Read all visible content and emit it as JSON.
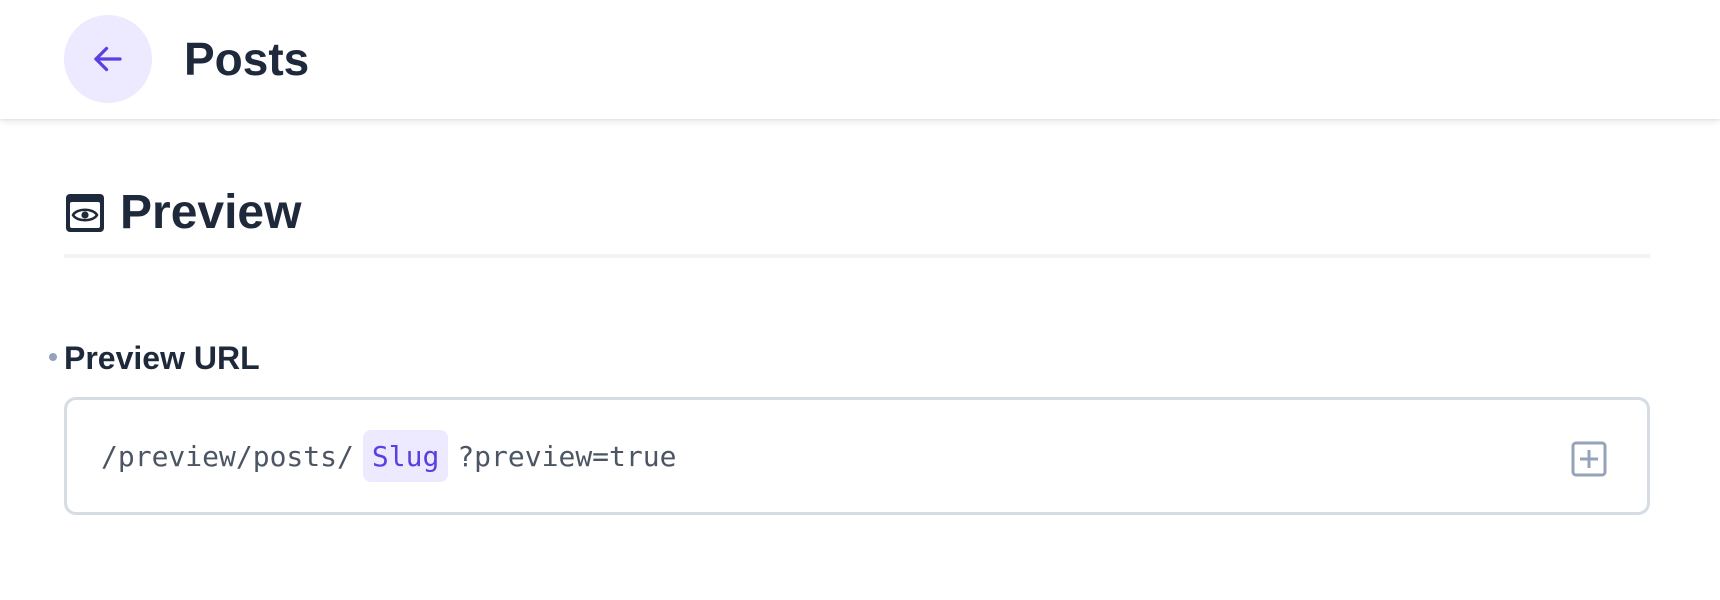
{
  "header": {
    "back_icon": "arrow-left-icon",
    "title": "Posts"
  },
  "section": {
    "icon": "browser-eye-icon",
    "title": "Preview"
  },
  "field": {
    "label": "Preview URL",
    "url_prefix": "/preview/posts/",
    "slug_token": "Slug",
    "url_suffix": "?preview=true",
    "add_icon": "plus-square-icon"
  },
  "colors": {
    "accent": "#5b3fe0",
    "accent_soft": "#ede9fe",
    "text": "#1e293b",
    "border": "#d5dce3"
  }
}
